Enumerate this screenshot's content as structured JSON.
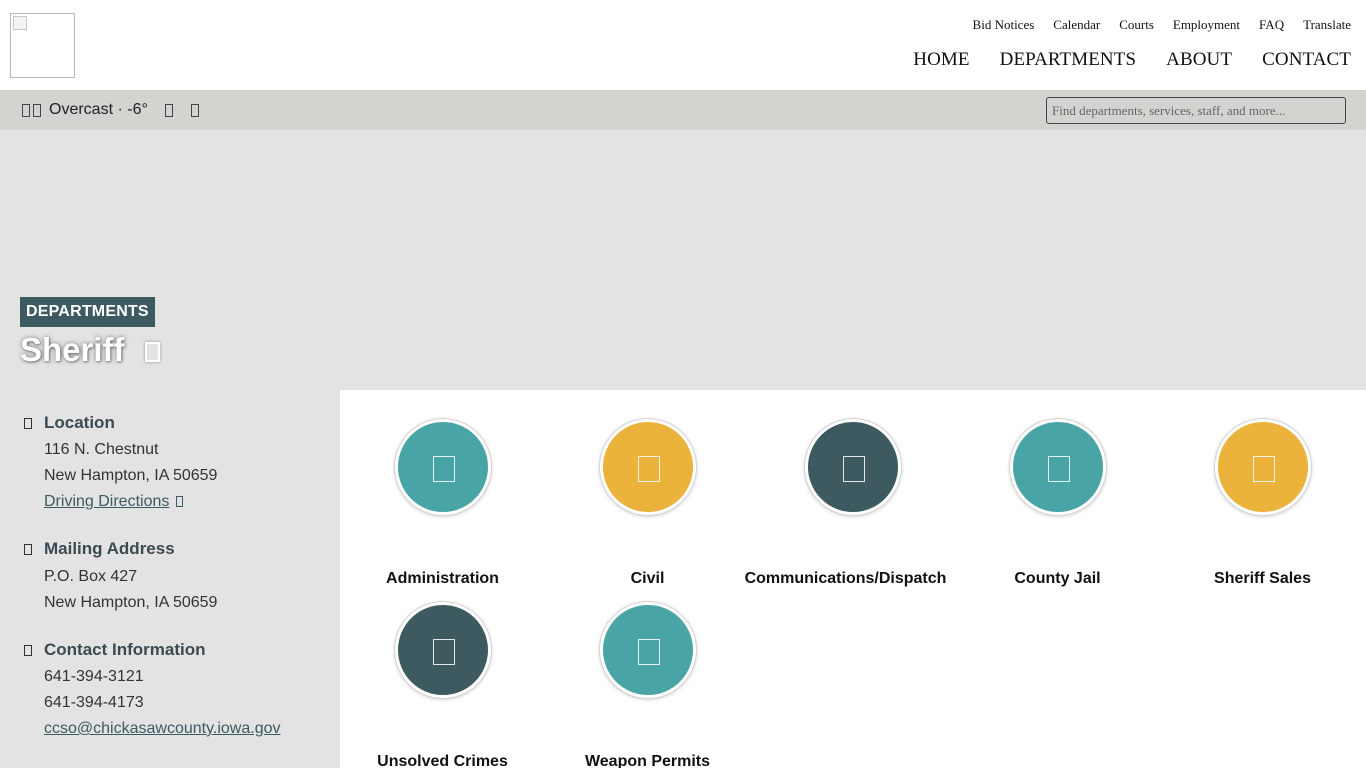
{
  "header": {
    "utility_links": [
      "Bid Notices",
      "Calendar",
      "Courts",
      "Employment",
      "FAQ",
      "Translate"
    ],
    "main_nav": [
      "HOME",
      "DEPARTMENTS",
      "ABOUT",
      "CONTACT"
    ]
  },
  "weather": {
    "text": "Overcast · -6°"
  },
  "search": {
    "placeholder": "Find departments, services, staff, and more..."
  },
  "hero": {
    "badge": "DEPARTMENTS",
    "title": "Sheriff"
  },
  "sidebar": {
    "location": {
      "heading": "Location",
      "street": "116 N. Chestnut",
      "city": "New Hampton, IA 50659",
      "directions_link": "Driving Directions"
    },
    "mailing": {
      "heading": "Mailing Address",
      "box": "P.O. Box 427",
      "city": "New Hampton, IA 50659"
    },
    "contact": {
      "heading": "Contact Information",
      "phone1": "641-394-3121",
      "phone2": "641-394-4173",
      "email": "ccso@chickasawcounty.iowa.gov"
    }
  },
  "tiles": [
    {
      "label": "Administration",
      "color": "#49a4a6"
    },
    {
      "label": "Civil",
      "color": "#ebb33b"
    },
    {
      "label": "Communications/Dispatch",
      "color": "#3c5a5f"
    },
    {
      "label": "County Jail",
      "color": "#49a4a6"
    },
    {
      "label": "Sheriff Sales",
      "color": "#ebb33b"
    },
    {
      "label": "Unsolved Crimes",
      "color": "#3c5a5f"
    },
    {
      "label": "Weapon Permits",
      "color": "#49a4a6"
    }
  ],
  "colors": {
    "teal": "#49a4a6",
    "gold": "#ebb33b",
    "slate": "#3c5a5f",
    "weather_bar": "#d1d4cf",
    "hero_bg": "#e3e3e3"
  }
}
